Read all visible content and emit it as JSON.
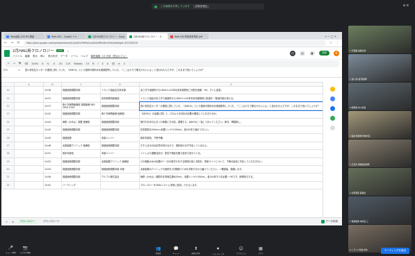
{
  "banner": {
    "text": "この画面を共有しています",
    "stop": "共有を停止"
  },
  "corner": "⊞ ☰",
  "tabs": [
    {
      "label": "Web会議 (ZOOM) 開始",
      "fav": "blue"
    },
    {
      "label": "Web-HAC - Google ドキ",
      "fav": "blue"
    },
    {
      "label": "2月HAG用クロノロジー - Goog",
      "fav": "green"
    },
    {
      "label": "2月HAG用クロノロジー - G",
      "fav": "green",
      "active": true
    },
    {
      "label": "Web-HAC事前参考資料.pdf",
      "fav": "red"
    }
  ],
  "tab_controls": "+  ─  ▢  ✕",
  "url": "https://docs.google.com/spreadsheets/d/1cj2q9GcPWXsGvo0ZaXZ8tt4Hrx5QG/edit#gid=811450319",
  "sheet": {
    "title": "2月HAG用クロノロジー",
    "badge": "XLSX",
    "menus": [
      "ファイル",
      "編集",
      "表示",
      "挿入",
      "表示形式",
      "データ",
      "ツール",
      "ヘルプ"
    ],
    "last_edit": "最終編集: 18 分前（長谷川さん）",
    "share": "共有",
    "avatar": "K"
  },
  "toolbar": [
    "↶",
    "↷",
    "🖶",
    "⌫",
    "100%",
    "¥",
    "%",
    ".0",
    ".00",
    "123",
    "Roboto",
    "10",
    "B",
    "I",
    "S",
    "A",
    "田",
    "≡",
    "↕",
    "⋮"
  ],
  "formula": {
    "ref": "E15",
    "fx": "fx",
    "content": "四川省衛生センターの運営に関していた、「JADOU」という団体が飲料水を無償配布していた。「ここはうちで乗るからいいよ」と言われたんですが、このままで良いでしょうか？"
  },
  "columns": [
    "",
    "A",
    "B",
    "C",
    "D",
    "E"
  ],
  "rows": [
    {
      "n": "10",
      "time": "14:28",
      "from": "保健医療調整本部",
      "to": "トラック協会広島県本部",
      "text": "あさぎり保健所から1600人×20本を県本部物資ご分配を依頼 ~OK、すぐに回答。"
    },
    {
      "n": "11",
      "time": "14:31",
      "from": "保健医療調整本部",
      "to": "県本部物資医療品",
      "text": "トラック協会があさぎり保健所から1600人×20本を県本部物資に配達中 ~配達可能か見える。"
    },
    {
      "n": "12",
      "time": "14:37",
      "from": "食十字病院医療班 保健医療 080-2900-3344",
      "to": "保健医療調整本部",
      "text": "四川省衛生センターの運営に関していた、「JADOU」という団体が飲料水を無償配布していた。「ここはうちで乗るからいいよ」と言われたんですが、このままで良いでしょうか？"
    },
    {
      "n": "13",
      "time": "14:42",
      "from": "保健医療調整本部",
      "to": "食十字病院医療 医療班",
      "text": "「JADOU」の活動に関して、どのような対応が必要か確認していただけるか。"
    },
    {
      "n": "14",
      "time": "14:44",
      "from": "病院（かみよ）調整 医療班",
      "to": "保健医療調整本部",
      "text": "受付中日中の止まった時間にも対応。調整もで、JADOUに一括しておいてください。新手、問題無し。"
    },
    {
      "n": "15",
      "time": "14:45",
      "from": "保健医療調整本部",
      "to": "保健医療調整本部",
      "text": "在宅救急を500mL×乳酸リンゲル500mL、各200本で届けてほしい。"
    },
    {
      "n": "16",
      "time": "14:45",
      "from": "保健医療",
      "to": "本部メンバー",
      "text": "保本本部長、下痢予備。"
    },
    {
      "n": "17",
      "time": "14:48",
      "from": "北原製薬クリニック 医療班",
      "to": "保健医療調整本部",
      "text": "ホホえまのほぼ全員中切れなので、透析用のまず不足していません。"
    },
    {
      "n": "18",
      "time": "14:51",
      "from": "保本本部長",
      "to": "本部メンバー",
      "text": "トイレより避難住民が、急性下痢症を疑う症状で訪れている。"
    },
    {
      "n": "19",
      "time": "14:52",
      "from": "保健医療調整本部",
      "to": "北原製薬クリニック 医療班",
      "text": "どの程度の水が必要か? 一日の受付けをする時間の量と手配を、専用ライトについて、下痢の症状に不足していただきたい。"
    },
    {
      "n": "20",
      "time": "14:54",
      "from": "保健医療調整本部",
      "to": "保健医療調整本部 本部",
      "text": "北原製薬のクリニックの透析を2日間続けて水を手配するから届けてください。～確認後、連絡します。"
    },
    {
      "n": "21",
      "time": "14:56",
      "from": "保健医療調整本部",
      "to": "アルプル株式会社",
      "text": "病院（かみよ）期間中を同時生理水50mL、乳酸リンゲル500mL。各200本すつ中必要 ~OKです、節得持ちする。"
    },
    {
      "n": "22",
      "time": "15:02",
      "from": "リーディング",
      "to": "",
      "text": "クロノロジーをToDoリストに非常に感応してもらいます。"
    }
  ],
  "sheet_tabs": {
    "add": "+",
    "list": "≡",
    "tab1": "クロノロジー",
    "tab2": "クロノロジー2",
    "explore": "データ探索"
  },
  "gallery": [
    {
      "name": "1 行政職  佐藤太郎",
      "color": "#6b7f5e"
    },
    {
      "name": "1 第4 第3課 保健師",
      "color": "#7d8c9a"
    },
    {
      "name": "2 総務課  中川直美",
      "color": "#5e6a72"
    },
    {
      "name": "1 医療 保健師 現場対応",
      "color": "#a3987a"
    },
    {
      "name": "1 広島市 保健医療調整",
      "color": "#8a8070"
    },
    {
      "name": "1 北原製薬 医療班",
      "color": "#65705a"
    },
    {
      "name": "1 保健医療 本部長 三",
      "color": "#4f5a66"
    },
    {
      "name": "2 トラック協会 鈴木",
      "color": "#7a6e61"
    }
  ],
  "controls": {
    "mute": "ミュート解除",
    "video": "ビデオの開始",
    "end": "ミーティングを退出"
  },
  "center_icons": [
    "参加者",
    "チャット",
    "画面の共有",
    "レコーディング",
    "リアクション",
    "アプリ"
  ]
}
